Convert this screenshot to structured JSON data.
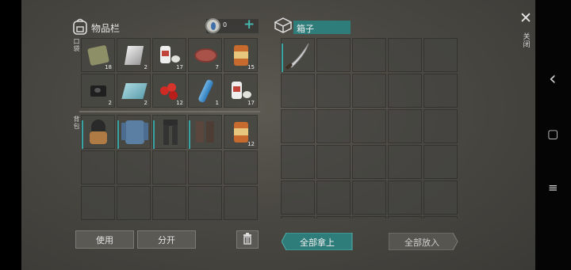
{
  "inventory": {
    "title": "物品栏",
    "currency": "0",
    "add_symbol": "+",
    "side_label_pockets": "口袋",
    "side_label_backpack": "背包",
    "pockets": [
      {
        "icon": "cloth-icon",
        "qty": "18"
      },
      {
        "icon": "metal-plate-icon",
        "qty": "2"
      },
      {
        "icon": "bandage-icon",
        "qty": "17"
      },
      {
        "icon": "meat-icon",
        "qty": "7"
      },
      {
        "icon": "canned-food-icon",
        "qty": "15"
      },
      {
        "icon": "battery-icon",
        "qty": "2"
      },
      {
        "icon": "glass-icon",
        "qty": "2"
      },
      {
        "icon": "berries-icon",
        "qty": "12"
      },
      {
        "icon": "water-bottle-icon",
        "qty": "1"
      },
      {
        "icon": "bandage-icon",
        "qty": "17"
      }
    ],
    "backpack": [
      {
        "icon": "balaclava-icon",
        "qty": ""
      },
      {
        "icon": "jacket-icon",
        "qty": ""
      },
      {
        "icon": "pants-icon",
        "qty": ""
      },
      {
        "icon": "boots-icon",
        "qty": ""
      },
      {
        "icon": "canned-food-icon",
        "qty": "12"
      }
    ],
    "use_label": "使用",
    "split_label": "分开"
  },
  "box": {
    "title": "箱子",
    "items": [
      {
        "icon": "machete-icon"
      }
    ],
    "take_all_label": "全部拿上",
    "put_all_label": "全部放入"
  },
  "close": {
    "symbol": "✕",
    "label": "关闭"
  },
  "nav": {
    "back": "‹",
    "home": "▢",
    "menu": "≡"
  },
  "colors": {
    "accent": "#2f7d7a",
    "equip": "#3aa3a3"
  }
}
